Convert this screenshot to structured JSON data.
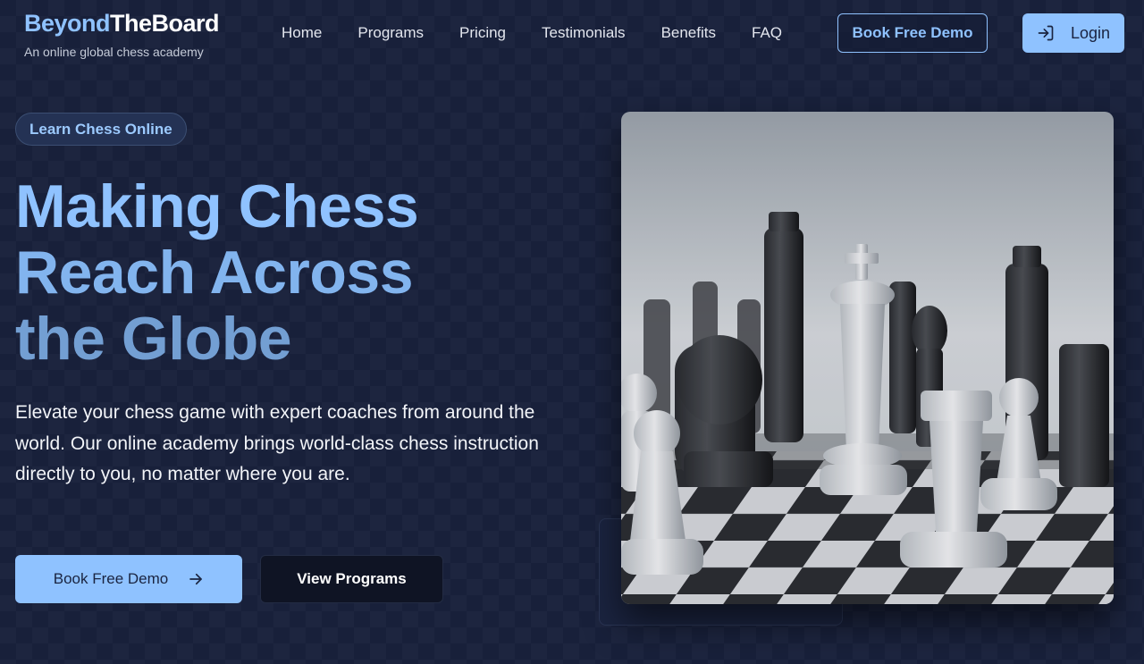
{
  "brand": {
    "name_part1": "Beyond",
    "name_part2": "TheBoard",
    "tagline": "An online global chess academy"
  },
  "nav": {
    "items": [
      {
        "label": "Home"
      },
      {
        "label": "Programs"
      },
      {
        "label": "Pricing"
      },
      {
        "label": "Testimonials"
      },
      {
        "label": "Benefits"
      },
      {
        "label": "FAQ"
      }
    ],
    "demo_button": "Book Free Demo",
    "login_button": "Login",
    "login_icon": "login-arrow-icon"
  },
  "hero": {
    "badge": "Learn Chess Online",
    "headline_lines": [
      "Making Chess",
      "Reach Across",
      "the Globe"
    ],
    "description": "Elevate your chess game with expert coaches from around the world. Our online academy brings world-class chess instruction directly to you, no matter where you are.",
    "primary_button": "Book Free Demo",
    "primary_button_icon": "arrow-right-icon",
    "secondary_button": "View Programs",
    "image_subject": "chess-pieces-photo"
  },
  "colors": {
    "accent": "#8fc2ff",
    "background": "#18203a",
    "dark_button": "#0f1424"
  }
}
